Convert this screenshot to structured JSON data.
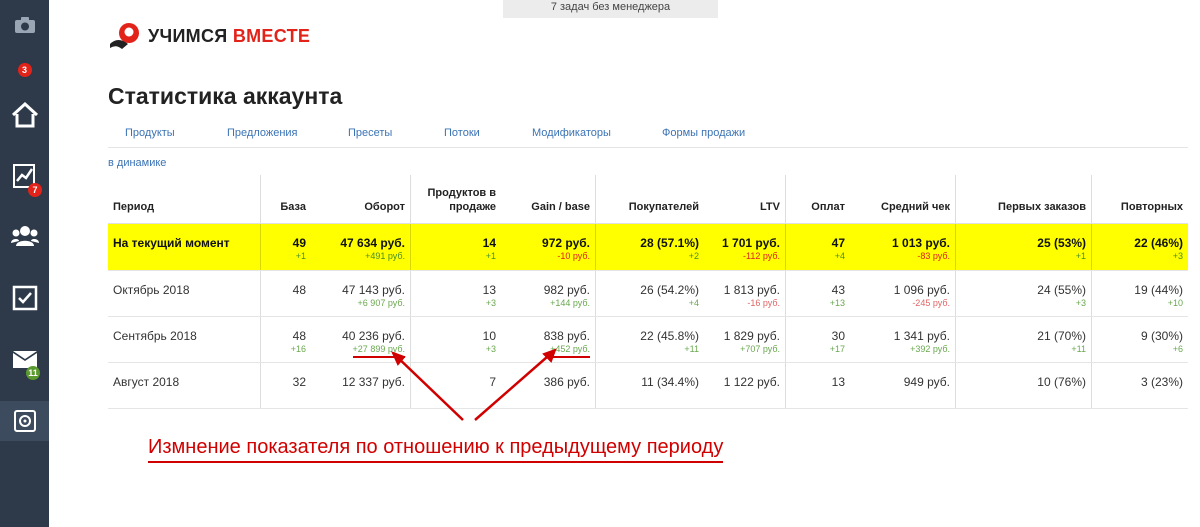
{
  "sidebar": {
    "badge_top": "3",
    "badge_stats": "7",
    "badge_messages": "11",
    "accent_red": "#e2231a",
    "accent_green": "#5a9a2f"
  },
  "top_notice": "7 задач без менеджера",
  "logo": {
    "word1": "УЧИМСЯ",
    "word2": "ВМЕСТЕ"
  },
  "page_title": "Статистика аккаунта",
  "tabs": [
    "Продукты",
    "Предложения",
    "Пресеты",
    "Потоки",
    "Модификаторы",
    "Формы продажи"
  ],
  "dynamics_link": "в динамике",
  "table": {
    "headers": [
      "Период",
      "База",
      "Оборот",
      "Продуктов в продаже",
      "Gain / base",
      "Покупателей",
      "LTV",
      "Оплат",
      "Средний чек",
      "Первых заказов",
      "Повторных"
    ],
    "rows": [
      {
        "period": "На текущий момент",
        "cells": [
          {
            "v": "49",
            "d": "+1",
            "t": "pos"
          },
          {
            "v": "47 634 руб.",
            "d": "+491 руб.",
            "t": "pos"
          },
          {
            "v": "14",
            "d": "+1",
            "t": "pos"
          },
          {
            "v": "972 руб.",
            "d": "-10 руб.",
            "t": "neg"
          },
          {
            "v": "28 (57.1%)",
            "d": "+2",
            "t": "pos"
          },
          {
            "v": "1 701 руб.",
            "d": "-112 руб.",
            "t": "neg"
          },
          {
            "v": "47",
            "d": "+4",
            "t": "pos"
          },
          {
            "v": "1 013 руб.",
            "d": "-83 руб.",
            "t": "neg"
          },
          {
            "v": "25 (53%)",
            "d": "+1",
            "t": "pos"
          },
          {
            "v": "22 (46%)",
            "d": "+3",
            "t": "pos"
          }
        ]
      },
      {
        "period": "Октябрь 2018",
        "cells": [
          {
            "v": "48",
            "d": "",
            "t": "pos"
          },
          {
            "v": "47 143 руб.",
            "d": "+6 907 руб.",
            "t": "pos"
          },
          {
            "v": "13",
            "d": "+3",
            "t": "pos"
          },
          {
            "v": "982 руб.",
            "d": "+144 руб.",
            "t": "pos"
          },
          {
            "v": "26 (54.2%)",
            "d": "+4",
            "t": "pos"
          },
          {
            "v": "1 813 руб.",
            "d": "-16 руб.",
            "t": "neg"
          },
          {
            "v": "43",
            "d": "+13",
            "t": "pos"
          },
          {
            "v": "1 096 руб.",
            "d": "-245 руб.",
            "t": "neg"
          },
          {
            "v": "24 (55%)",
            "d": "+3",
            "t": "pos"
          },
          {
            "v": "19 (44%)",
            "d": "+10",
            "t": "pos"
          }
        ]
      },
      {
        "period": "Сентябрь 2018",
        "cells": [
          {
            "v": "48",
            "d": "+16",
            "t": "pos"
          },
          {
            "v": "40 236 руб.",
            "d": "+27 899 руб.",
            "t": "pos"
          },
          {
            "v": "10",
            "d": "+3",
            "t": "pos"
          },
          {
            "v": "838 руб.",
            "d": "+452 руб.",
            "t": "pos"
          },
          {
            "v": "22 (45.8%)",
            "d": "+11",
            "t": "pos"
          },
          {
            "v": "1 829 руб.",
            "d": "+707 руб.",
            "t": "pos"
          },
          {
            "v": "30",
            "d": "+17",
            "t": "pos"
          },
          {
            "v": "1 341 руб.",
            "d": "+392 руб.",
            "t": "pos"
          },
          {
            "v": "21 (70%)",
            "d": "+11",
            "t": "pos"
          },
          {
            "v": "9 (30%)",
            "d": "+6",
            "t": "pos"
          }
        ]
      },
      {
        "period": "Август 2018",
        "cells": [
          {
            "v": "32",
            "d": "",
            "t": "pos"
          },
          {
            "v": "12 337 руб.",
            "d": "",
            "t": "pos"
          },
          {
            "v": "7",
            "d": "",
            "t": "pos"
          },
          {
            "v": "386 руб.",
            "d": "",
            "t": "pos"
          },
          {
            "v": "11 (34.4%)",
            "d": "",
            "t": "pos"
          },
          {
            "v": "1 122 руб.",
            "d": "",
            "t": "pos"
          },
          {
            "v": "13",
            "d": "",
            "t": "pos"
          },
          {
            "v": "949 руб.",
            "d": "",
            "t": "pos"
          },
          {
            "v": "10 (76%)",
            "d": "",
            "t": "pos"
          },
          {
            "v": "3 (23%)",
            "d": "",
            "t": "pos"
          }
        ]
      }
    ]
  },
  "annotation": "Измнение показателя по отношению к предыдущему периоду",
  "colors": {
    "highlight": "#ffff00",
    "positive": "#6aa84f",
    "negative": "#e06666",
    "annotation": "#d00000",
    "link": "#3b73b5"
  }
}
